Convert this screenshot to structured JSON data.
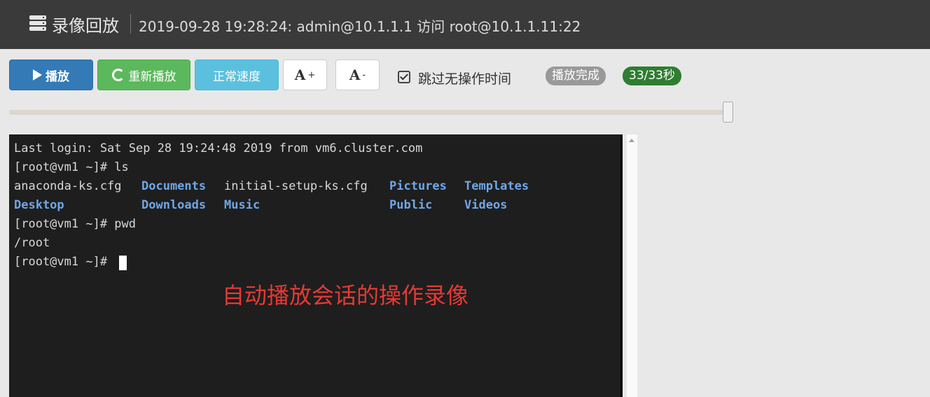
{
  "header": {
    "icon": "server-icon",
    "title": "录像回放",
    "info": "2019-09-28 19:28:24: admin@10.1.1.1 访问 root@10.1.1.11:22"
  },
  "toolbar": {
    "play_label": "播放",
    "replay_label": "重新播放",
    "speed_label": "正常速度",
    "font_plus_letter": "A",
    "font_plus_sign": "+",
    "font_minus_letter": "A",
    "font_minus_sign": "-",
    "skip_idle_label": "跳过无操作时间",
    "skip_idle_checked": true,
    "status_badge": "播放完成",
    "time_badge": "33/33秒"
  },
  "progress": {
    "current_seconds": 33,
    "total_seconds": 33,
    "fraction": 1.0
  },
  "terminal": {
    "line1": "Last login: Sat Sep 28 19:24:48 2019 from vm6.cluster.com",
    "line2": "[root@vm1 ~]# ls",
    "files_row1": [
      "anaconda-ks.cfg",
      "Documents",
      "initial-setup-ks.cfg",
      "Pictures",
      "Templates"
    ],
    "files_row2": [
      "Desktop",
      "Downloads",
      "Music",
      "Public",
      "Videos"
    ],
    "line5": "[root@vm1 ~]# pwd",
    "line6": "/root",
    "line7": "[root@vm1 ~]# ",
    "overlay_text": "自动播放会话的操作录像"
  },
  "colors": {
    "header_bg": "#3a3a3a",
    "play": "#337ab7",
    "replay": "#5cb85c",
    "speed": "#5bc0de",
    "status_badge": "#999999",
    "time_badge": "#2f7d32",
    "terminal_bg": "#1e1e1e",
    "directory": "#6fa7e6",
    "overlay": "#e53935"
  }
}
